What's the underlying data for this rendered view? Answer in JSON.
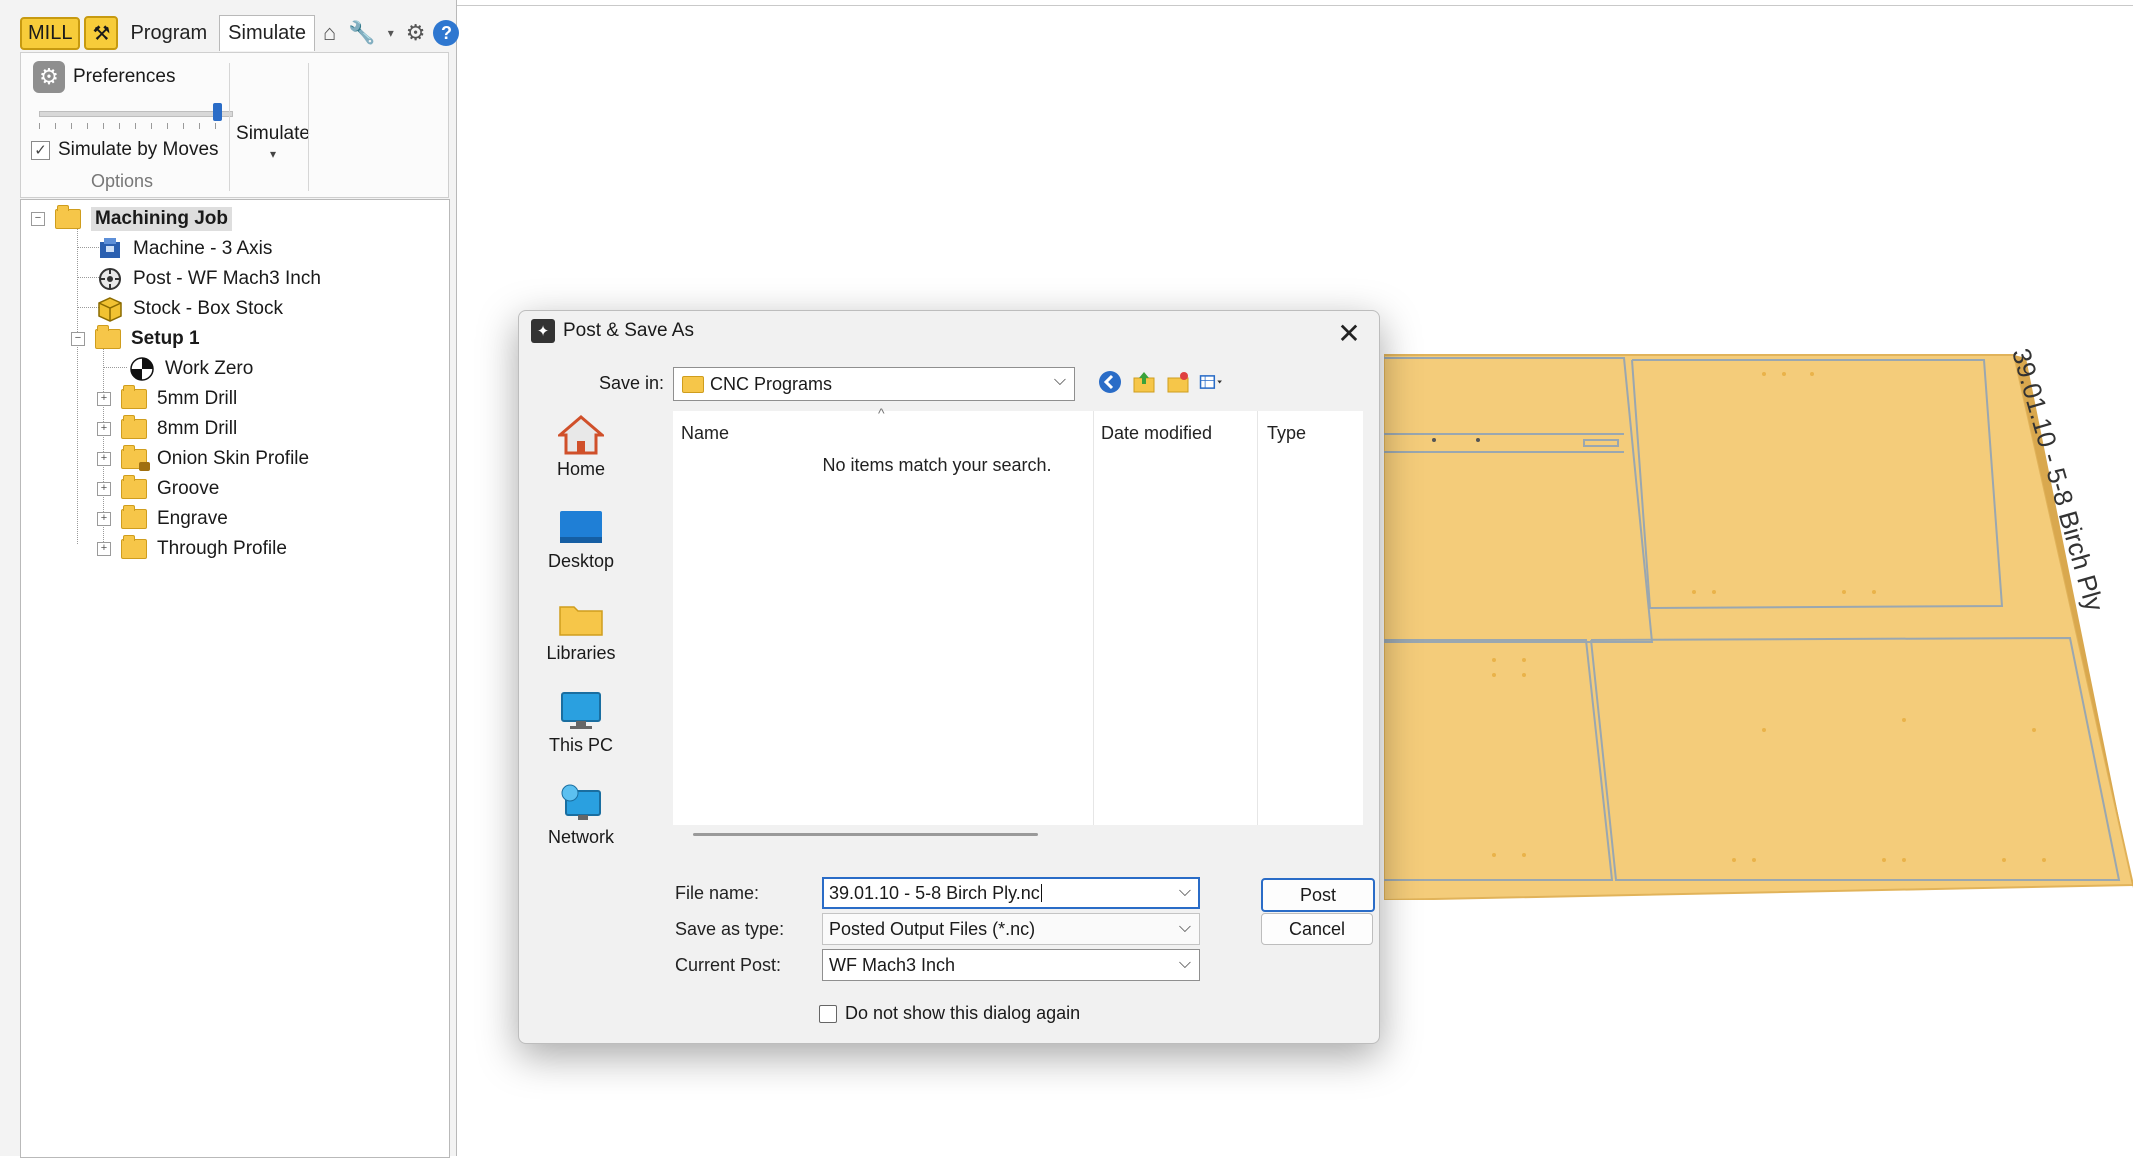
{
  "ribbon": {
    "mill_badge": "MILL",
    "tabs": [
      {
        "label": "Program"
      },
      {
        "label": "Simulate"
      }
    ],
    "preferences_label": "Preferences",
    "simulate_by_moves_label": "Simulate by Moves",
    "simulate_by_moves_checked": true,
    "options_group_label": "Options",
    "simulate_button_label": "Simulate",
    "speed_slider_level": 0.95
  },
  "tree": {
    "items": [
      {
        "label": "Machining Job"
      },
      {
        "label": "Machine - 3 Axis"
      },
      {
        "label": "Post - WF Mach3 Inch"
      },
      {
        "label": "Stock - Box Stock"
      },
      {
        "label": "Setup 1"
      },
      {
        "label": "Work Zero"
      },
      {
        "label": "5mm Drill"
      },
      {
        "label": "8mm Drill"
      },
      {
        "label": "Onion Skin Profile"
      },
      {
        "label": "Groove"
      },
      {
        "label": "Engrave"
      },
      {
        "label": "Through Profile"
      }
    ]
  },
  "viewport": {
    "sheet_label": "39.01.10 - 5-8 Birch Ply",
    "sheet_color": "#f4cc7a"
  },
  "dialog": {
    "title": "Post & Save As",
    "save_in_label": "Save in:",
    "save_in_value": "CNC Programs",
    "places": [
      {
        "label": "Home"
      },
      {
        "label": "Desktop"
      },
      {
        "label": "Libraries"
      },
      {
        "label": "This PC"
      },
      {
        "label": "Network"
      }
    ],
    "columns": [
      {
        "label": "Name"
      },
      {
        "label": "Date modified"
      },
      {
        "label": "Type"
      }
    ],
    "empty_message": "No items match your search.",
    "file_name_label": "File name:",
    "file_name_value": "39.01.10 - 5-8 Birch Ply.nc",
    "save_as_type_label": "Save as type:",
    "save_as_type_value": "Posted Output Files (*.nc)",
    "current_post_label": "Current Post:",
    "current_post_value": "WF Mach3 Inch",
    "post_button": "Post",
    "cancel_button": "Cancel",
    "dont_show_label": "Do not show this dialog again",
    "dont_show_checked": false
  },
  "colors": {
    "accent": "#2a6cc7",
    "folder": "#f6c649",
    "mill_badge": "#f7cc3a"
  }
}
